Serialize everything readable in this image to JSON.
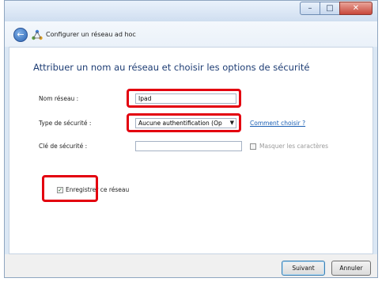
{
  "window": {
    "nav_title": "Configurer un réseau ad hoc",
    "caption_buttons": {
      "minimize": "–",
      "maximize": "□",
      "close": "✕"
    }
  },
  "form": {
    "heading": "Attribuer un nom au réseau et choisir les options de sécurité",
    "network_name_label": "Nom réseau :",
    "network_name_value": "Ipad",
    "security_type_label": "Type de sécurité :",
    "security_type_value": "Aucune authentification (Op",
    "choose_link": "Comment choisir ?",
    "security_key_label": "Clé de sécurité :",
    "security_key_value": "",
    "hide_chars_label": "Masquer les caractères",
    "save_network_label": "Enregistrer ce réseau",
    "save_network_checked": true
  },
  "footer": {
    "next_label": "Suivant",
    "cancel_label": "Annuler"
  },
  "colors": {
    "highlight": "#e3000f",
    "heading": "#1e3d74",
    "link": "#1a5fb4"
  },
  "icons": {
    "back": "back-arrow-icon",
    "network": "adhoc-network-icon",
    "dropdown": "chevron-down-icon"
  }
}
